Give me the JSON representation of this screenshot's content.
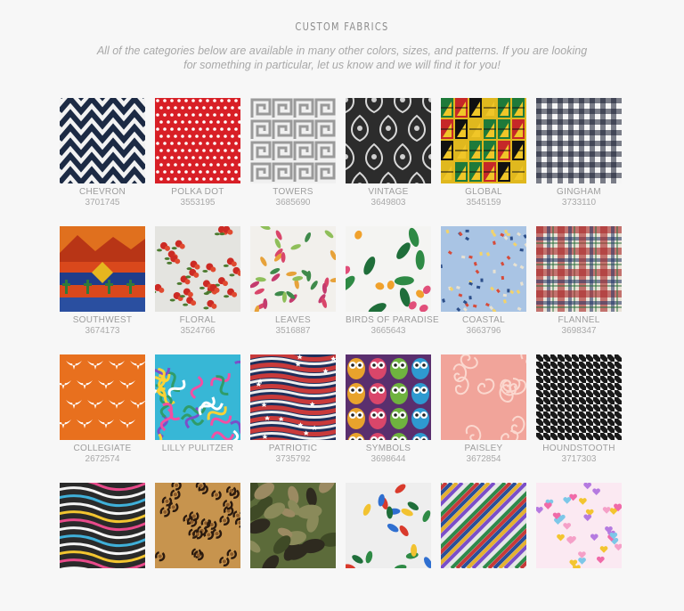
{
  "header": {
    "title": "CUSTOM FABRICS",
    "intro": "All of the categories below are available in many other colors, sizes, and patterns. If you are looking for something in particular, let us know and we will find it for you!"
  },
  "fabrics": [
    {
      "name": "CHEVRON",
      "code": "3701745",
      "icon": "chevron-fabric-swatch"
    },
    {
      "name": "POLKA DOT",
      "code": "3553195",
      "icon": "polka-dot-fabric-swatch"
    },
    {
      "name": "TOWERS",
      "code": "3685690",
      "icon": "greek-key-fabric-swatch"
    },
    {
      "name": "VINTAGE",
      "code": "3649803",
      "icon": "damask-fabric-swatch"
    },
    {
      "name": "GLOBAL",
      "code": "3545159",
      "icon": "kente-fabric-swatch"
    },
    {
      "name": "GINGHAM",
      "code": "3733110",
      "icon": "gingham-fabric-swatch"
    },
    {
      "name": "SOUTHWEST",
      "code": "3674173",
      "icon": "southwest-fabric-swatch"
    },
    {
      "name": "FLORAL",
      "code": "3524766",
      "icon": "floral-fabric-swatch"
    },
    {
      "name": "LEAVES",
      "code": "3516887",
      "icon": "leaves-fabric-swatch"
    },
    {
      "name": "BIRDS OF PARADISE",
      "code": "3665643",
      "icon": "tropical-fabric-swatch"
    },
    {
      "name": "COASTAL",
      "code": "3663796",
      "icon": "coastal-fabric-swatch"
    },
    {
      "name": "FLANNEL",
      "code": "3698347",
      "icon": "plaid-fabric-swatch"
    },
    {
      "name": "COLLEGIATE",
      "code": "2672574",
      "icon": "longhorn-fabric-swatch"
    },
    {
      "name": "LILLY PULITZER",
      "code": "",
      "icon": "lilly-pulitzer-fabric-swatch"
    },
    {
      "name": "PATRIOTIC",
      "code": "3735792",
      "icon": "flag-fabric-swatch"
    },
    {
      "name": "SYMBOLS",
      "code": "3698644",
      "icon": "owl-fabric-swatch"
    },
    {
      "name": "PAISLEY",
      "code": "3672854",
      "icon": "paisley-fabric-swatch"
    },
    {
      "name": "HOUNDSTOOTH",
      "code": "3717303",
      "icon": "houndstooth-fabric-swatch"
    },
    {
      "name": "",
      "code": "",
      "icon": "zebra-fabric-swatch"
    },
    {
      "name": "",
      "code": "",
      "icon": "leopard-fabric-swatch"
    },
    {
      "name": "",
      "code": "",
      "icon": "camouflage-fabric-swatch"
    },
    {
      "name": "",
      "code": "",
      "icon": "parrot-fabric-swatch"
    },
    {
      "name": "",
      "code": "",
      "icon": "stripe-fabric-swatch"
    },
    {
      "name": "",
      "code": "",
      "icon": "hearts-fabric-swatch"
    }
  ]
}
